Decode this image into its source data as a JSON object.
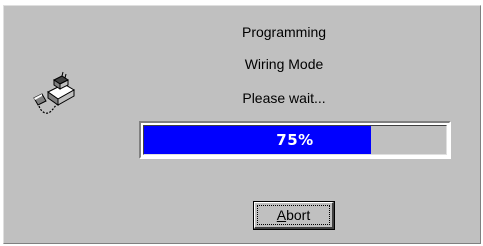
{
  "dialog": {
    "messages": {
      "line1": "Programming",
      "line2": "Wiring Mode",
      "line3": "Please wait..."
    },
    "icon": "programming-device-icon",
    "progress": {
      "percent": 75,
      "label": "75%"
    },
    "abort_button": {
      "mnemonic": "A",
      "label_rest": "bort"
    },
    "colors": {
      "dialog_background": "#c0c0c0",
      "progress_fill": "#0000ff",
      "progress_text": "#ffffff"
    }
  }
}
